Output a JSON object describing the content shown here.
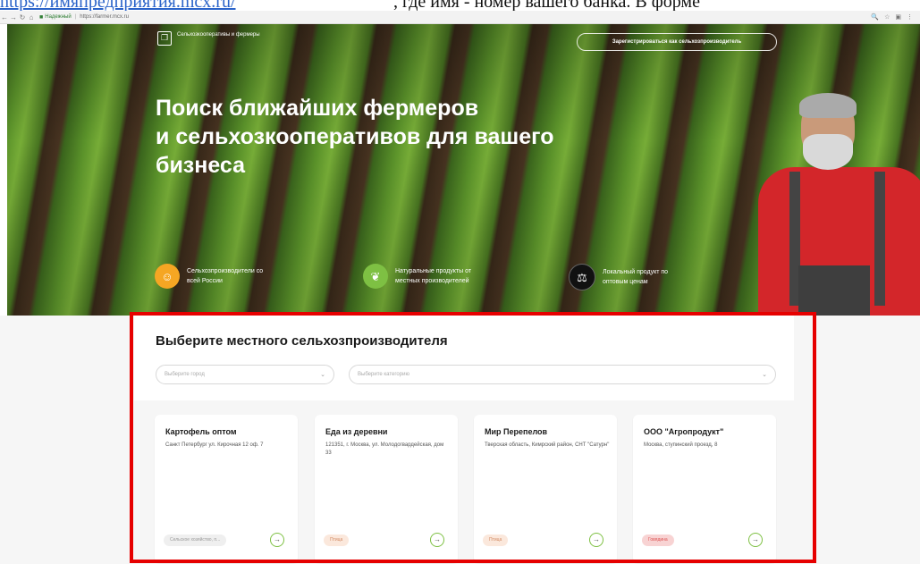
{
  "doc": {
    "link_text": "https://имяпредприятия.mcx.ru/",
    "tail_text": ", где имя - номер вашего банка. В форме"
  },
  "browser": {
    "secure_label": "Надежный",
    "url": "https://farmer.mcx.ru"
  },
  "hero": {
    "logo_text": "Сельхозкооперативы и фермеры",
    "register_button": "Зарегистрироваться как сельхозпроизводитель",
    "title_line1": "Поиск ближайших фермеров",
    "title_line2": "и сельхозкооперативов для вашего",
    "title_line3": "бизнеса",
    "features": [
      {
        "icon": "farmer-icon",
        "text_line1": "Сельхозпроизводители со",
        "text_line2": "всей России"
      },
      {
        "icon": "leaf-icon",
        "text_line1": "Натуральные продукты от",
        "text_line2": "местных производителей"
      },
      {
        "icon": "scale-icon",
        "text_line1": "Локальный продукт по",
        "text_line2": "оптовым ценам"
      }
    ]
  },
  "section": {
    "title": "Выберите местного сельхозпроизводителя",
    "city_placeholder": "Выберите город",
    "category_placeholder": "Выберите категорию"
  },
  "cards": [
    {
      "title": "Картофель оптом",
      "address": "Санкт Петербург ул. Кирочная 12 оф. 7",
      "tag": "Сельское хозяйство, п..."
    },
    {
      "title": "Еда из деревни",
      "address": "121351, г. Москва, ул. Молодогвардейская, дом 33",
      "tag": "Птица"
    },
    {
      "title": "Мир Перепелов",
      "address": "Тверская область, Кимрский район, СНТ \"Сатурн\"",
      "tag": "Птица"
    },
    {
      "title": "ООО \"Агропродукт\"",
      "address": "Москва, ступинский проезд, 8",
      "tag": "Говядина"
    }
  ],
  "colors": {
    "highlight": "#e60000",
    "accent_green": "#7ec043",
    "shirt_red": "#d3262a"
  }
}
